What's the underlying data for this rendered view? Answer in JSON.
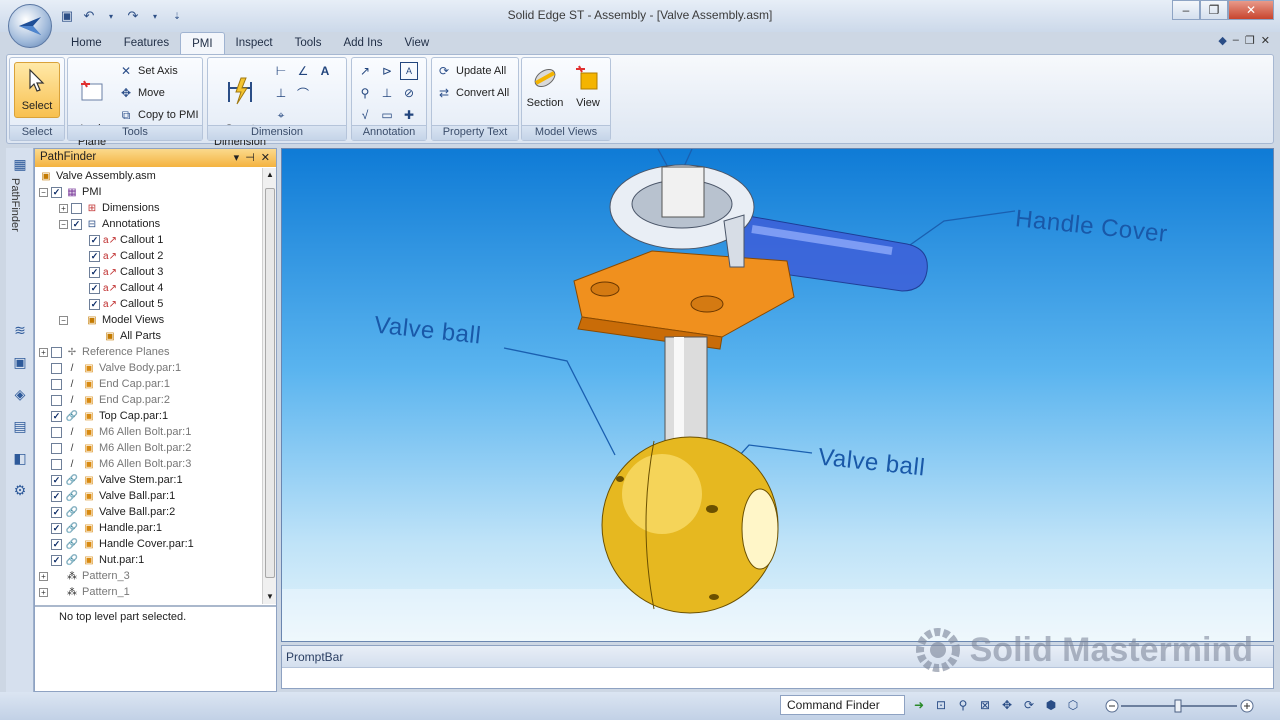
{
  "window": {
    "title": "Solid Edge ST - Assembly - [Valve Assembly.asm]"
  },
  "ribbon": {
    "tabs": [
      "Home",
      "Features",
      "PMI",
      "Inspect",
      "Tools",
      "Add Ins",
      "View"
    ],
    "active_tab": "PMI",
    "groups": {
      "select": {
        "label": "Select",
        "select_button": "Select"
      },
      "tools": {
        "label": "Tools",
        "lock_plane": "Lock\nPlane",
        "set_axis": "Set Axis",
        "move": "Move",
        "copy_to_pmi": "Copy to PMI"
      },
      "dimension": {
        "label": "Dimension",
        "smart_dimension": "Smart\nDimension"
      },
      "annotation": {
        "label": "Annotation"
      },
      "property_text": {
        "label": "Property Text",
        "update_all": "Update All",
        "convert_all": "Convert All"
      },
      "model_views": {
        "label": "Model Views",
        "section": "Section",
        "view": "View"
      }
    }
  },
  "pathfinder": {
    "title": "PathFinder",
    "root": "Valve Assembly.asm",
    "items": [
      {
        "label": "PMI",
        "level": 1,
        "expander": "-",
        "checked": true,
        "icon": "pmi-icon"
      },
      {
        "label": "Dimensions",
        "level": 2,
        "expander": "+",
        "checked": false,
        "icon": "dimensions-icon"
      },
      {
        "label": "Annotations",
        "level": 2,
        "expander": "-",
        "checked": true,
        "icon": "annotations-icon"
      },
      {
        "label": "Callout 1",
        "level": 3,
        "checked": true,
        "icon": "callout-icon"
      },
      {
        "label": "Callout 2",
        "level": 3,
        "checked": true,
        "icon": "callout-icon"
      },
      {
        "label": "Callout 3",
        "level": 3,
        "checked": true,
        "icon": "callout-icon"
      },
      {
        "label": "Callout 4",
        "level": 3,
        "checked": true,
        "icon": "callout-icon"
      },
      {
        "label": "Callout 5",
        "level": 3,
        "checked": true,
        "icon": "callout-icon"
      },
      {
        "label": "Model Views",
        "level": 2,
        "expander": "-",
        "checked": null,
        "icon": "model-views-icon"
      },
      {
        "label": "All Parts",
        "level": 3,
        "checked": null,
        "icon": "view-icon"
      },
      {
        "label": "Reference Planes",
        "level": 1,
        "expander": "+",
        "checked": false,
        "icon": "reference-planes-icon",
        "dim": true
      },
      {
        "label": "Valve Body.par:1",
        "level": 1,
        "checked": false,
        "icon": "part-icon",
        "dim": true
      },
      {
        "label": "End Cap.par:1",
        "level": 1,
        "checked": false,
        "icon": "part-icon",
        "dim": true
      },
      {
        "label": "End Cap.par:2",
        "level": 1,
        "checked": false,
        "icon": "part-icon",
        "dim": true
      },
      {
        "label": "Top Cap.par:1",
        "level": 1,
        "checked": true,
        "icon": "part-icon"
      },
      {
        "label": "M6 Allen Bolt.par:1",
        "level": 1,
        "checked": false,
        "icon": "part-icon",
        "dim": true
      },
      {
        "label": "M6 Allen Bolt.par:2",
        "level": 1,
        "checked": false,
        "icon": "part-icon",
        "dim": true
      },
      {
        "label": "M6 Allen Bolt.par:3",
        "level": 1,
        "checked": false,
        "icon": "part-icon",
        "dim": true
      },
      {
        "label": "Valve Stem.par:1",
        "level": 1,
        "checked": true,
        "icon": "part-icon"
      },
      {
        "label": "Valve Ball.par:1",
        "level": 1,
        "checked": true,
        "icon": "part-icon"
      },
      {
        "label": "Valve Ball.par:2",
        "level": 1,
        "checked": true,
        "icon": "part-icon"
      },
      {
        "label": "Handle.par:1",
        "level": 1,
        "checked": true,
        "icon": "part-icon"
      },
      {
        "label": "Handle Cover.par:1",
        "level": 1,
        "checked": true,
        "icon": "part-icon"
      },
      {
        "label": "Nut.par:1",
        "level": 1,
        "checked": true,
        "icon": "part-icon"
      },
      {
        "label": "Pattern_3",
        "level": 1,
        "expander": "+",
        "checked": null,
        "icon": "pattern-icon",
        "dim": true
      },
      {
        "label": "Pattern_1",
        "level": 1,
        "expander": "+",
        "checked": null,
        "icon": "pattern-icon",
        "dim": true
      }
    ],
    "status": "No top level part selected."
  },
  "viewport": {
    "callouts": [
      "Handle Cover",
      "Valve ball",
      "Valve ball"
    ],
    "colors": {
      "sky_top": "#0f7bd6",
      "orange_part": "#f0901e",
      "ball_gold": "#e6b820",
      "callout_text": "#1958a8"
    }
  },
  "promptbar": {
    "label": "PromptBar",
    "watermark": "Solid Mastermind"
  },
  "statusbar": {
    "command_finder": "Command Finder"
  }
}
